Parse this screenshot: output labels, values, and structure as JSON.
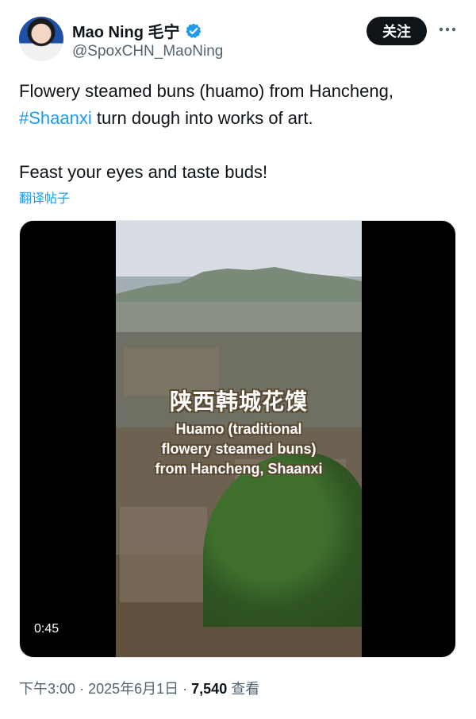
{
  "user": {
    "name": "Mao Ning 毛宁",
    "handle": "@SpoxCHN_MaoNing"
  },
  "actions": {
    "follow": "关注"
  },
  "tweet": {
    "line1": "Flowery steamed buns (huamo) from Hancheng,",
    "hashtag": "#Shaanxi",
    "line2_rest": " turn dough into works of art.",
    "line3": "Feast your eyes and taste buds!",
    "translate": "翻译帖子"
  },
  "video": {
    "title_cn": "陕西韩城花馍",
    "subtitle": "Huamo (traditional\nflowery steamed buns)\nfrom Hancheng, Shaanxi",
    "duration": "0:45"
  },
  "meta": {
    "time": "下午3:00",
    "date": "2025年6月1日",
    "views": "7,540",
    "views_label": "查看"
  },
  "colors": {
    "accent": "#1d9bf0",
    "text": "#0f1419",
    "secondary": "#536471"
  }
}
